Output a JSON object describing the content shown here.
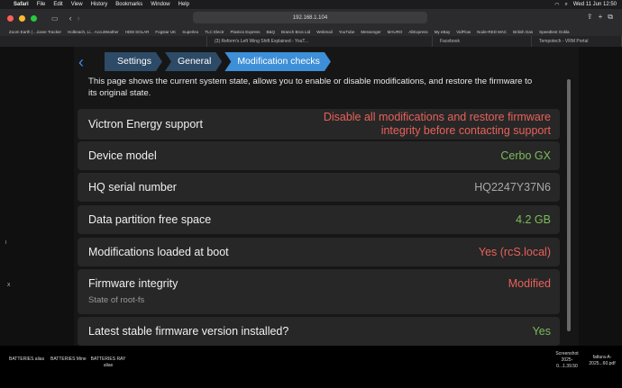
{
  "menubar": {
    "items": [
      "Safari",
      "File",
      "Edit",
      "View",
      "History",
      "Bookmarks",
      "Window",
      "Help"
    ],
    "clock": "Wed 11 Jun  12:50"
  },
  "browser": {
    "url": "192.168.1.104"
  },
  "bookmarks": [
    "Zoom Earth | ...icane Tracker",
    "Holbeach, Li... AccuWeather",
    "HDM SOLAR",
    "Fogstar UK",
    "Superleo",
    "TLC Electr",
    "Plastics Express",
    "B&Q",
    "Branch Bros Ltd",
    "Webmail",
    "YouTube",
    "Messenger",
    "MAURO",
    "AliExpress",
    "My eBay",
    "VidFlow",
    "Node-RED MAC",
    "British Gas",
    "Speedtest Ookla"
  ],
  "tabs": [
    {
      "label": "(3) Reform's Left Wing Shift Explained - YouT...",
      "active": false
    },
    {
      "label": "Facebook",
      "active": false
    },
    {
      "label": "Tempotech - VRM Portal",
      "active": false
    }
  ],
  "breadcrumb": {
    "items": [
      "Settings",
      "General",
      "Modification checks"
    ]
  },
  "intro": "This page shows the current system state, allows you to enable or disable modifications, and restore the firmware to its original state.",
  "rows": [
    {
      "label": "Victron Energy support",
      "value": "Disable all modifications and restore firmware integrity before contacting support",
      "status": "error"
    },
    {
      "label": "Device model",
      "value": "Cerbo GX",
      "status": "ok"
    },
    {
      "label": "HQ serial number",
      "value": "HQ2247Y37N6",
      "status": "neutral"
    },
    {
      "label": "Data partition free space",
      "value": "4.2 GB",
      "status": "ok"
    },
    {
      "label": "Modifications loaded at boot",
      "value": "Yes (rcS.local)",
      "status": "error"
    },
    {
      "label": "Firmware integrity",
      "sub": "State of root-fs",
      "value": "Modified",
      "status": "error"
    },
    {
      "label": "Latest stable firmware version installed?",
      "value": "Yes",
      "status": "ok"
    }
  ],
  "colors": {
    "ok": "#7dbb5b",
    "error": "#e8615a",
    "neutral": "#a8a8a8",
    "accent": "#3d8fd8"
  },
  "dock": {
    "items": [
      "BATTERIES alias",
      "BATTERIES Mine",
      "BATTERIES RAY alias"
    ],
    "files": [
      "Screenshot 2025-0...1.39.50",
      "fattura-A-2025...60.pdf"
    ]
  }
}
